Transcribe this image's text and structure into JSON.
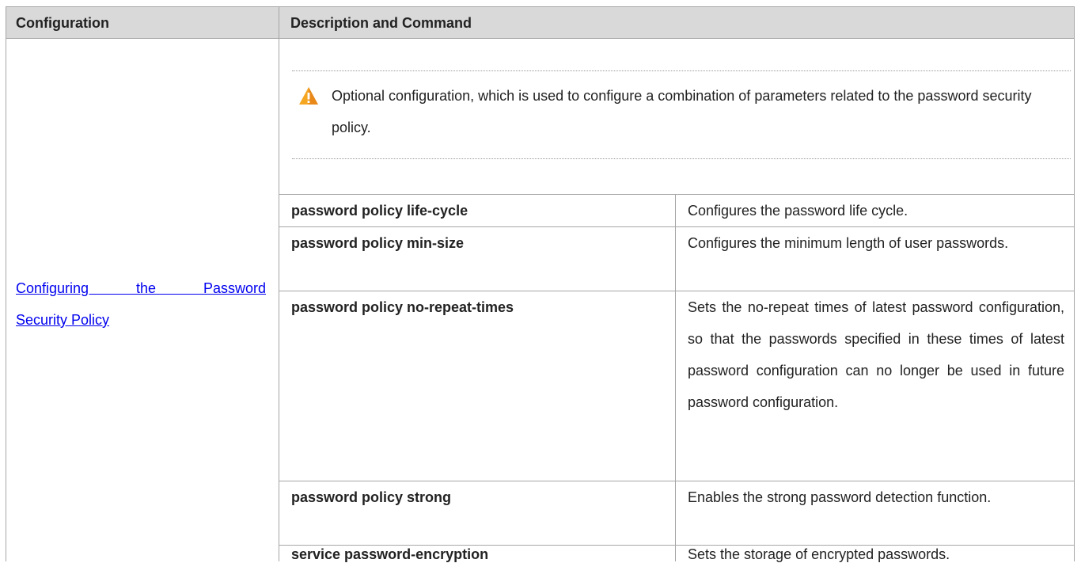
{
  "table": {
    "headers": {
      "configuration": "Configuration",
      "description": "Description and Command"
    },
    "configuration_link": {
      "line1": "Configuring the Password",
      "line2": "Security Policy"
    },
    "note": "Optional configuration, which is used to configure a combination of parameters related to the password security policy.",
    "rows": [
      {
        "command": "password policy life-cycle",
        "description": "Configures the password life cycle."
      },
      {
        "command": "password policy min-size",
        "description": "Configures the minimum length of user passwords."
      },
      {
        "command": "password policy no-repeat-times",
        "description": "Sets the no-repeat times of latest password configuration, so that the passwords specified in these times of latest password configuration can no longer be used in future password configuration."
      },
      {
        "command": "password policy strong",
        "description": "Enables the strong password detection function."
      },
      {
        "command": "service password-encryption",
        "description": "Sets the storage of encrypted passwords."
      }
    ]
  },
  "colors": {
    "header_bg": "#d9d9d9",
    "border": "#a6a6a6",
    "link": "#0000ee",
    "warning": "#f5a623"
  },
  "icons": {
    "note_icon": "warning-icon"
  }
}
